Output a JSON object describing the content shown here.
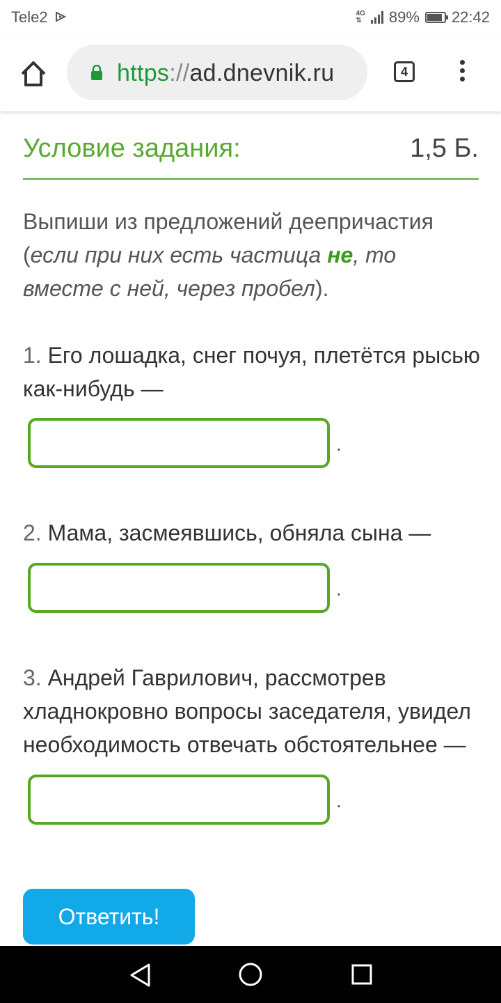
{
  "status_bar": {
    "carrier": "Tele2",
    "network": "4G",
    "battery": "89%",
    "battery_level": 0.89,
    "time": "22:42"
  },
  "browser": {
    "url_scheme": "https",
    "url_separator": "://",
    "url_host": "ad.dnevnik.ru",
    "tab_count": "4"
  },
  "task": {
    "heading": "Условие задания:",
    "points": "1,5 Б.",
    "instruction_main": "Выпиши из предложений деепричастия",
    "instruction_paren_open": "(",
    "instruction_italic_1": "если при них есть частица ",
    "instruction_particle": "не",
    "instruction_italic_2": ", то вместе с ней, через пробел",
    "instruction_paren_close": ").",
    "items": [
      {
        "number": "1.",
        "text": "Его лошадка, снег почуя, плетётся рысью как-нибудь —",
        "answer": "",
        "after": "."
      },
      {
        "number": "2.",
        "text": "Мама, засмеявшись, обняла сына —",
        "answer": "",
        "after": "."
      },
      {
        "number": "3.",
        "text": "Андрей Гаврилович, рассмотрев хладнокровно вопросы заседателя, увидел необходимость отвечать обстоятельнее —",
        "answer": "",
        "after": "."
      }
    ],
    "submit_label": "Ответить!"
  },
  "colors": {
    "accent_green": "#5aa832",
    "button_blue": "#12a9e8",
    "navbar": "#000000"
  }
}
